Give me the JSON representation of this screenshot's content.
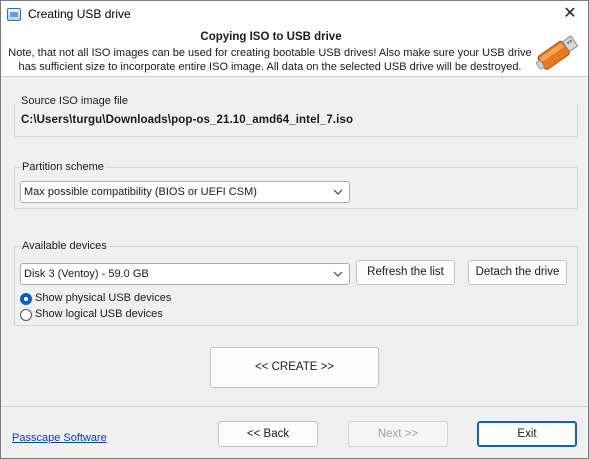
{
  "window": {
    "title": "Creating USB drive",
    "close_glyph": "✕"
  },
  "header": {
    "title": "Copying ISO to USB drive",
    "description": "Note, that not all ISO images can be used for creating bootable USB drives! Also make sure your USB drive has sufficient size to incorporate entire ISO image. All data on the selected USB drive will be destroyed.",
    "icon": "usb-drive-icon"
  },
  "source": {
    "label": "Source ISO image file",
    "path": "C:\\Users\\turgu\\Downloads\\pop-os_21.10_amd64_intel_7.iso"
  },
  "partition": {
    "label": "Partition scheme",
    "selected": "Max possible compatibility (BIOS or UEFI CSM)"
  },
  "devices": {
    "label": "Available devices",
    "selected": "Disk 3 (Ventoy) - 59.0 GB",
    "refresh_label": "Refresh the list",
    "detach_label": "Detach the drive",
    "radio_physical": "Show physical USB devices",
    "radio_logical": "Show logical USB devices",
    "selected_radio": "physical"
  },
  "create_label": "<< CREATE >>",
  "footer": {
    "link": "Passcape Software",
    "back_label": "<< Back",
    "next_label": "Next >>",
    "exit_label": "Exit"
  },
  "colors": {
    "accent": "#1a5fb4",
    "link": "#0b3ea8",
    "icon_orange": "#e8791d"
  }
}
